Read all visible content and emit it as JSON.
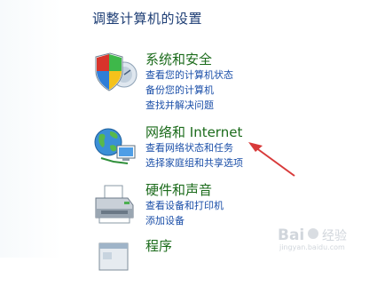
{
  "page": {
    "title": "调整计算机的设置"
  },
  "categories": [
    {
      "title": "系统和安全",
      "links": [
        "查看您的计算机状态",
        "备份您的计算机",
        "查找并解决问题"
      ],
      "icon": "shield-security-icon"
    },
    {
      "title": "网络和 Internet",
      "links": [
        "查看网络状态和任务",
        "选择家庭组和共享选项"
      ],
      "icon": "network-globe-icon"
    },
    {
      "title": "硬件和声音",
      "links": [
        "查看设备和打印机",
        "添加设备"
      ],
      "icon": "printer-icon"
    },
    {
      "title": "程序",
      "links": [],
      "icon": "programs-icon"
    }
  ],
  "annotation": {
    "arrow_color": "#d83a3a"
  },
  "watermark": {
    "text": "Bai经验",
    "sub": "jingyan.baidu.com"
  }
}
